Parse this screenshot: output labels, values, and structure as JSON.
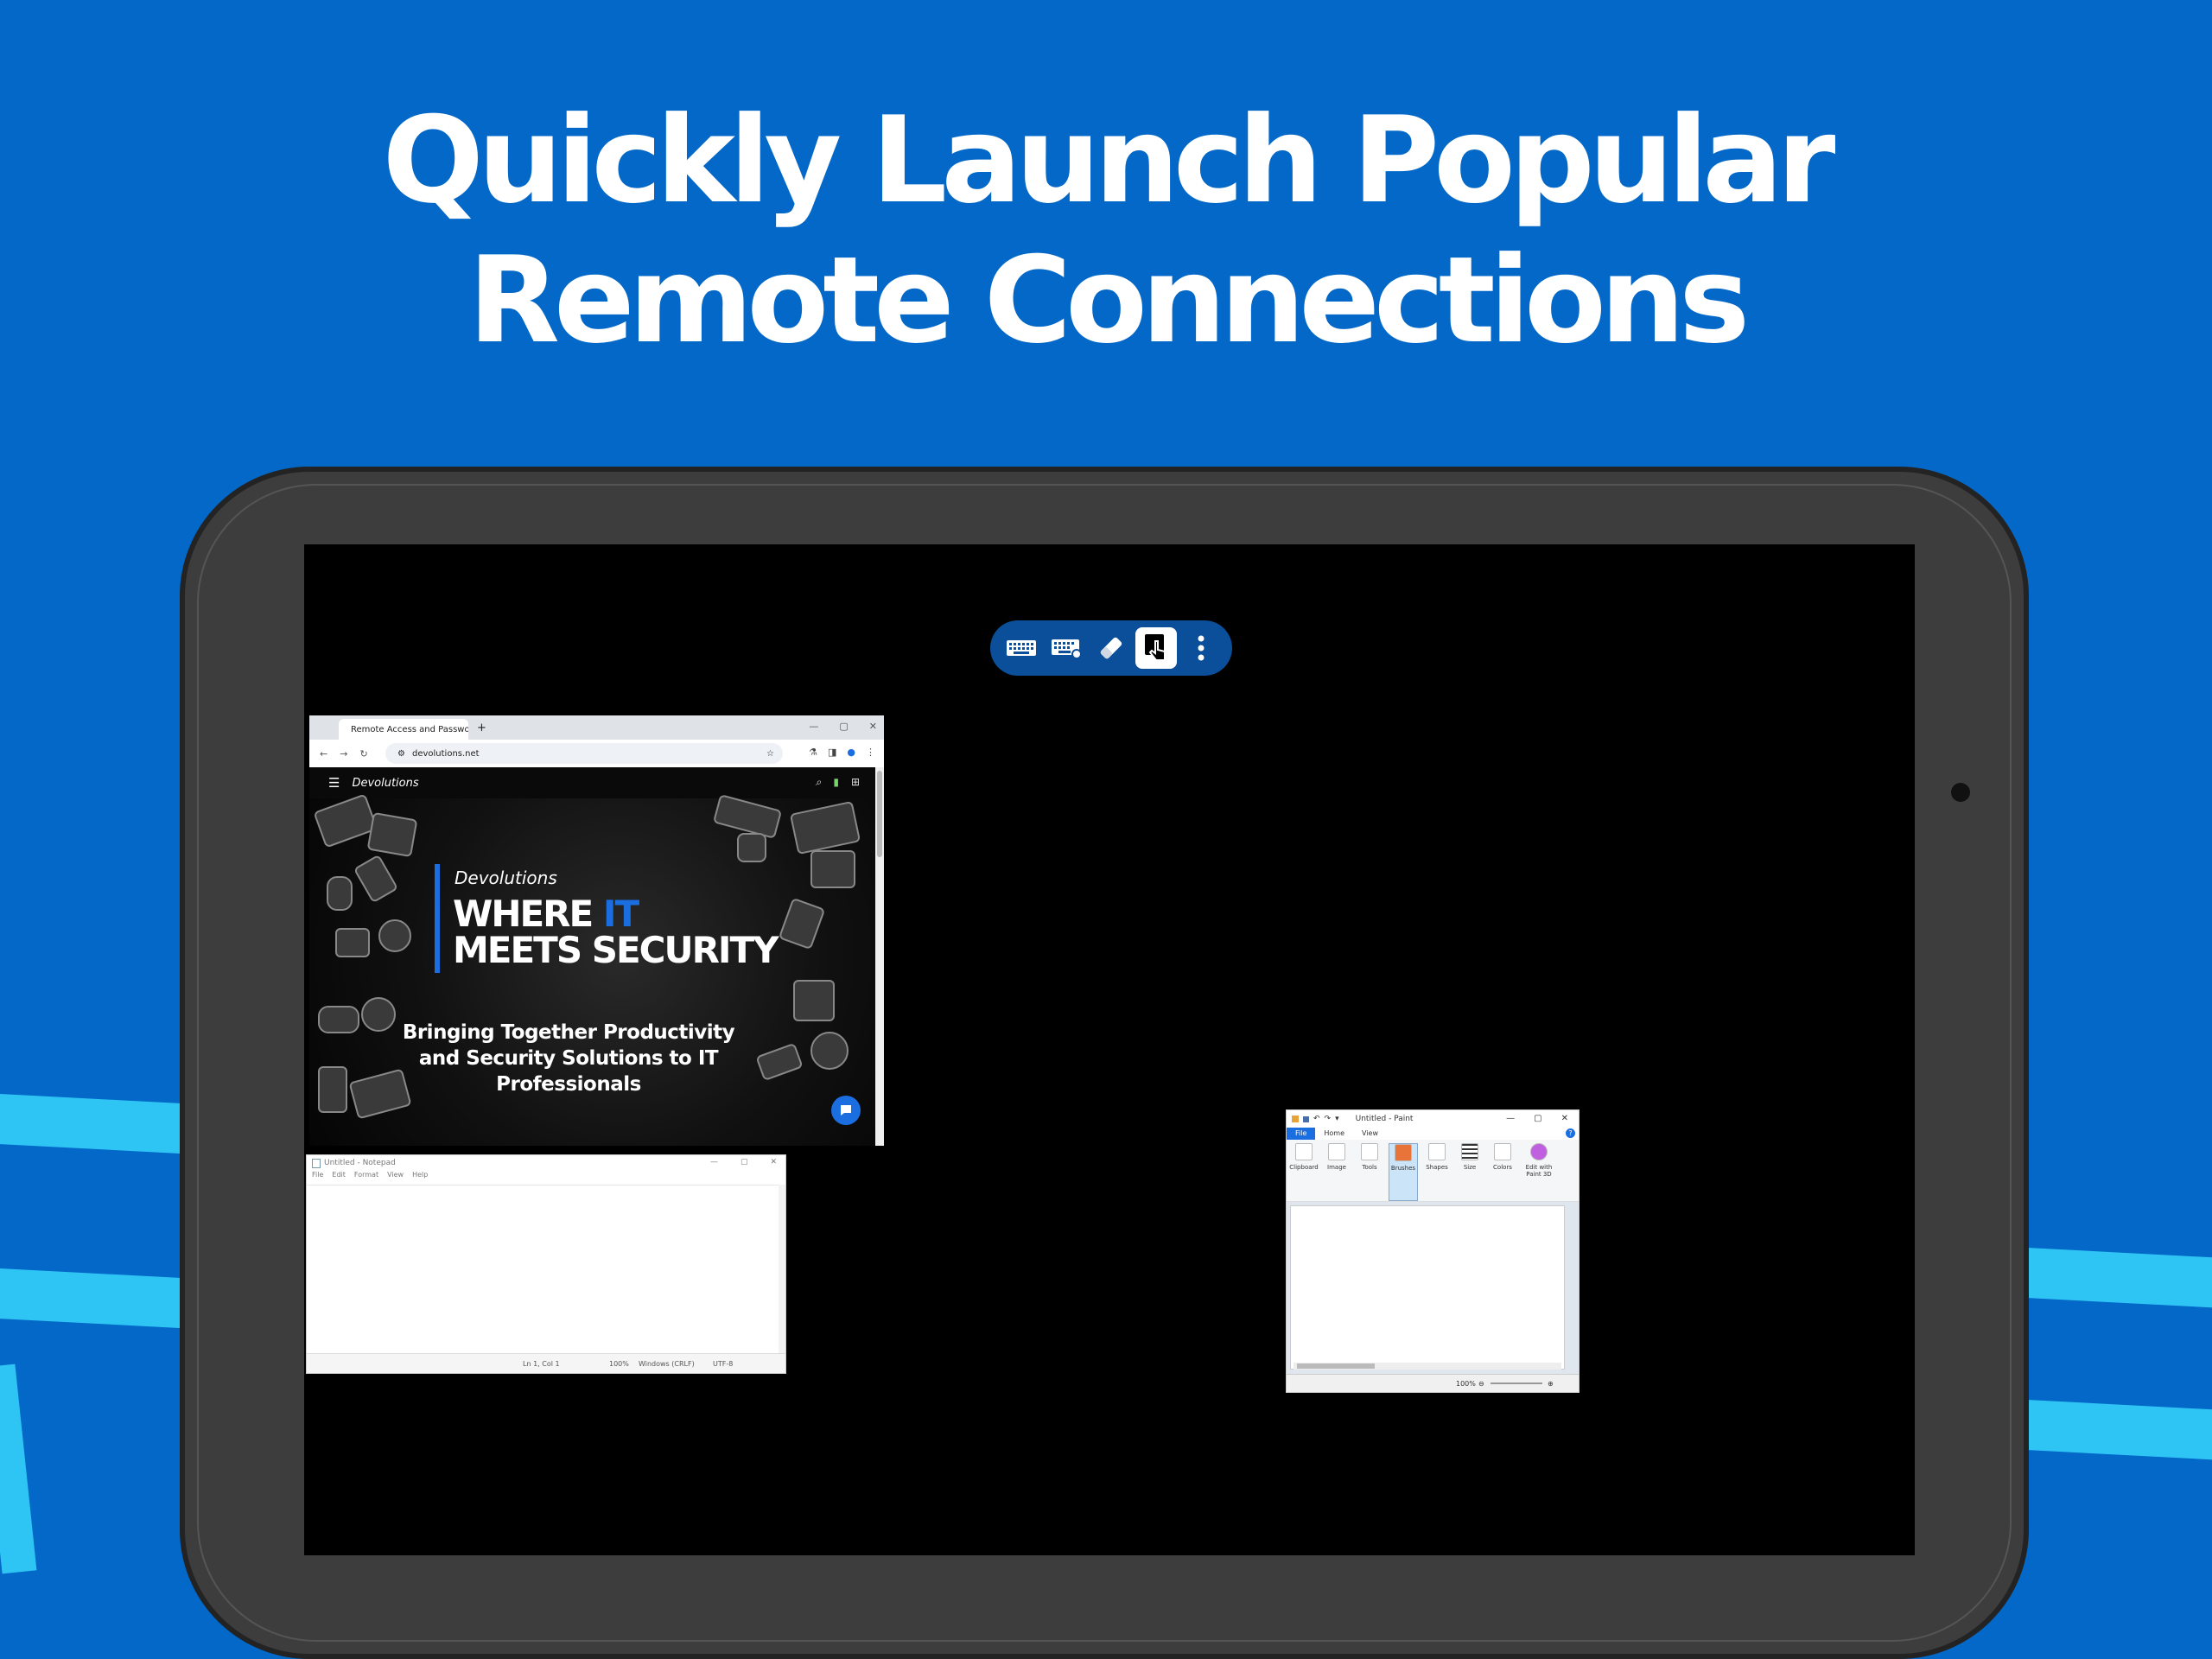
{
  "headline": {
    "line1": "Quickly Launch Popular",
    "line2": "Remote Connections"
  },
  "colors": {
    "background": "#0368c8",
    "accent_stripe": "#2ec4f4",
    "tablet_frame": "#3d3d3d",
    "toolbar": "#0b4e99",
    "brand_blue": "#1a6ee0"
  },
  "toolbar": {
    "items": [
      {
        "name": "keyboard-icon"
      },
      {
        "name": "keyboard-settings-icon"
      },
      {
        "name": "eraser-icon"
      },
      {
        "name": "touch-mode-icon",
        "active": true
      },
      {
        "name": "more-vertical-icon"
      }
    ]
  },
  "browser": {
    "tab_title": "Remote Access and Password M",
    "new_tab": "+",
    "url": "devolutions.net",
    "site": {
      "logo": "Devolutions",
      "hero_logo": "Devolutions",
      "headline_part1": "WHERE ",
      "headline_highlight": "IT",
      "headline_line2": "MEETS SECURITY",
      "subtitle": "Bringing Together Productivity and Security Solutions to IT Professionals"
    }
  },
  "notepad": {
    "title": "Untitled - Notepad",
    "menu": [
      "File",
      "Edit",
      "Format",
      "View",
      "Help"
    ],
    "status": {
      "position": "Ln 1, Col 1",
      "zoom": "100%",
      "line_endings": "Windows (CRLF)",
      "encoding": "UTF-8"
    }
  },
  "paint": {
    "title": "Untitled - Paint",
    "tabs": [
      "File",
      "Home",
      "View"
    ],
    "tools": [
      "Clipboard",
      "Image",
      "Tools",
      "Brushes",
      "Shapes",
      "Size",
      "Colors",
      "Edit with Paint 3D"
    ],
    "zoom": "100%"
  }
}
